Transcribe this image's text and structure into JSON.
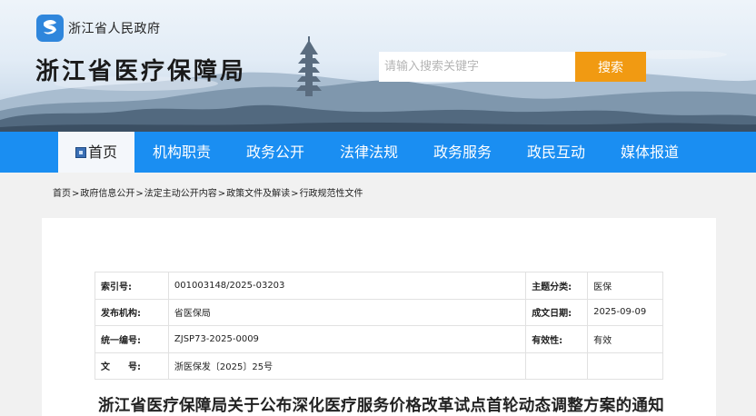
{
  "header": {
    "gov_name": "浙江省人民政府",
    "site_title": "浙江省医疗保障局",
    "search_placeholder": "请输入搜索关键字",
    "search_button": "搜索"
  },
  "nav": {
    "items": [
      {
        "label": "首页",
        "active": true
      },
      {
        "label": "机构职责"
      },
      {
        "label": "政务公开"
      },
      {
        "label": "法律法规"
      },
      {
        "label": "政务服务"
      },
      {
        "label": "政民互动"
      },
      {
        "label": "媒体报道"
      }
    ]
  },
  "breadcrumb": {
    "items": [
      "首页",
      "政府信息公开",
      "法定主动公开内容",
      "政策文件及解读",
      "行政规范性文件"
    ],
    "separator": ">"
  },
  "meta": {
    "rows": [
      {
        "k1": "索引号:",
        "v1": "001003148/2025-03203",
        "k2": "主题分类:",
        "v2": "医保"
      },
      {
        "k1": "发布机构:",
        "v1": "省医保局",
        "k2": "成文日期:",
        "v2": "2025-09-09"
      },
      {
        "k1": "统一编号:",
        "v1": "ZJSP73-2025-0009",
        "k2": "有效性:",
        "v2": "有效"
      },
      {
        "k1": "文　　号:",
        "v1": "浙医保发〔2025〕25号",
        "k2": "",
        "v2": ""
      }
    ]
  },
  "document": {
    "title": "浙江省医疗保障局关于公布深化医疗服务价格改革试点首轮动态调整方案的通知"
  },
  "colors": {
    "nav_bg": "#1a8ef2",
    "search_button": "#f19a12",
    "logo_bg": "#2f86dc"
  }
}
